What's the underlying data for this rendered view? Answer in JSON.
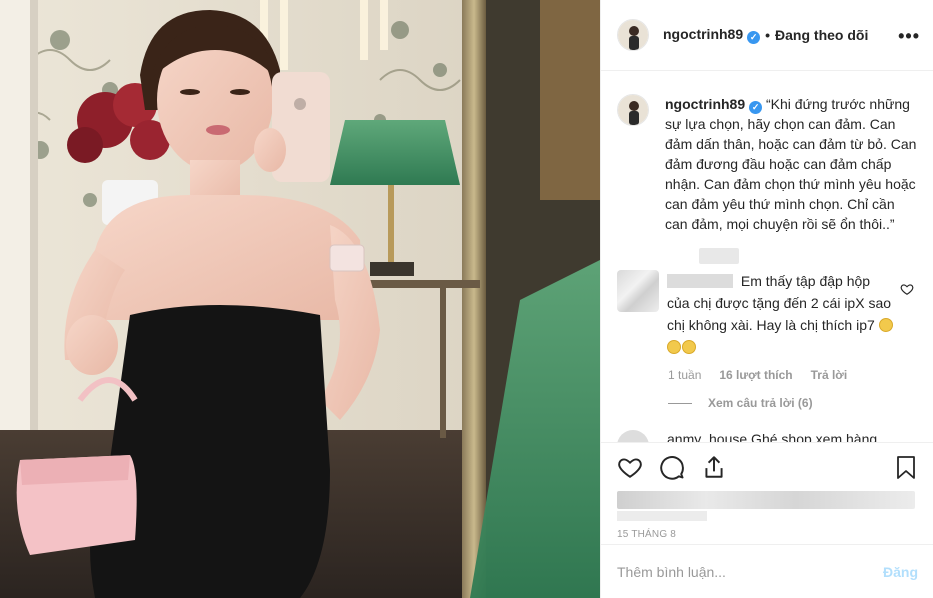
{
  "post": {
    "username": "ngoctrinh89",
    "follow_status": "Đang theo dõi",
    "more_label": "•••",
    "verified_glyph": "✓"
  },
  "caption": {
    "username": "ngoctrinh89",
    "text": "“Khi đứng trước những sự lựa chọn, hãy chọn can đảm. Can đảm dấn thân, hoặc can đảm từ bỏ. Can đảm đương đầu hoặc can đảm chấp nhận. Can đảm chọn thứ mình yêu hoặc can đảm yêu thứ mình chọn. Chỉ cần can đảm, mọi chuyện rồi sẽ ổn thôi..”"
  },
  "comment": {
    "text": "Em thấy tập đập hộp của chị được tặng đến 2 cái ipX sao chị không xài. Hay là chị thích ip7",
    "age": "1 tuần",
    "likes": "16 lượt thích",
    "reply": "Trả lời",
    "view_replies": "Xem câu trả lời (6)"
  },
  "next_comment": {
    "text": "anmy_house Ghé shop xem hàng"
  },
  "footer": {
    "date": "15 THÁNG 8",
    "comment_placeholder": "Thêm bình luận...",
    "post_label": "Đăng"
  },
  "icons": {
    "verified": "verified-badge-icon",
    "more": "more-options-icon",
    "like": "heart-icon",
    "comment": "comment-icon",
    "share": "share-icon",
    "save": "bookmark-icon",
    "comment_like": "heart-icon"
  },
  "colors": {
    "verified": "#3897f0",
    "post_disabled": "#b2dffc",
    "muted": "#999999",
    "text": "#262626"
  }
}
